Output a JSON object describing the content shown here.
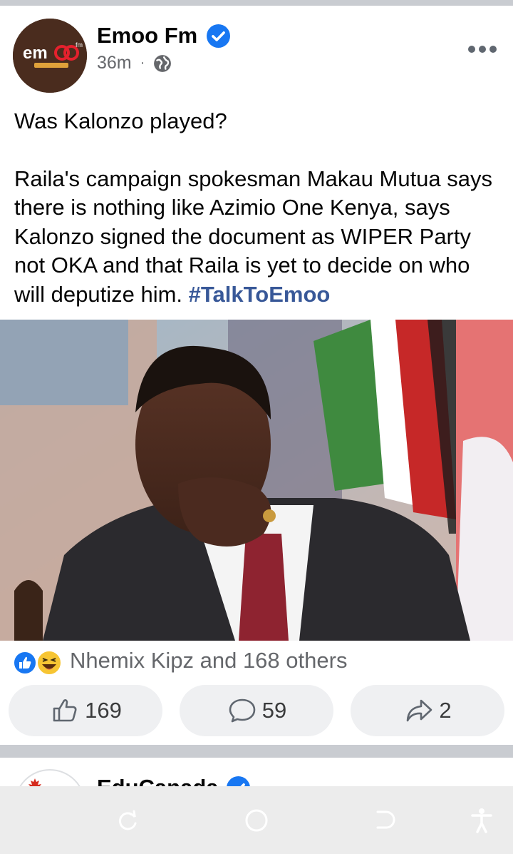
{
  "post": {
    "page_name": "Emoo Fm",
    "avatar_logo_text": "emoo fm",
    "time": "36m",
    "separator": "·",
    "text_title": "Was Kalonzo played?",
    "text_body": "Raila's campaign spokesman Makau Mutua says there is nothing like Azimio One Kenya, says Kalonzo signed the document as WIPER Party not OKA and that Raila is yet to decide on who will deputize him. ",
    "hashtag": "#TalkToEmoo"
  },
  "reactions": {
    "summary": "Nhemix Kipz and 168 others"
  },
  "actions": {
    "likes": "169",
    "comments": "59",
    "shares": "2"
  },
  "next_post": {
    "page_name": "EduCanada"
  },
  "icons": {
    "verified": "verified-badge-icon",
    "privacy": "globe-icon",
    "menu": "more-options-icon",
    "like": "like-icon",
    "comment": "comment-icon",
    "share": "share-icon",
    "nav": [
      "recent-apps-icon",
      "home-icon",
      "back-icon",
      "accessibility-icon"
    ]
  },
  "colors": {
    "accent_blue": "#1877f2",
    "hashtag_blue": "#385898",
    "muted_text": "#65676b",
    "button_bg": "#eff0f2"
  }
}
